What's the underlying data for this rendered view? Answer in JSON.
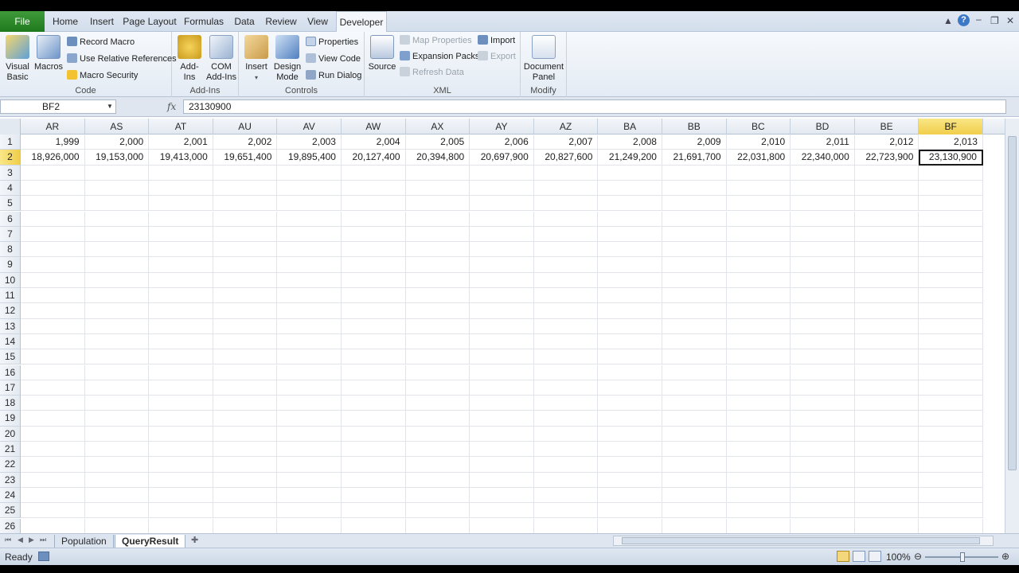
{
  "tabs": {
    "file": "File",
    "items": [
      "Home",
      "Insert",
      "Page Layout",
      "Formulas",
      "Data",
      "Review",
      "View",
      "Developer"
    ],
    "active": "Developer"
  },
  "ribbon": {
    "code": {
      "title": "Code",
      "visual_basic": "Visual\nBasic",
      "macros": "Macros",
      "record_macro": "Record Macro",
      "use_relative": "Use Relative References",
      "macro_security": "Macro Security"
    },
    "addins": {
      "title": "Add-Ins",
      "addins": "Add-Ins",
      "com_addins": "COM\nAdd-Ins"
    },
    "controls": {
      "title": "Controls",
      "insert": "Insert",
      "design_mode": "Design\nMode",
      "properties": "Properties",
      "view_code": "View Code",
      "run_dialog": "Run Dialog"
    },
    "xml": {
      "title": "XML",
      "source": "Source",
      "map_properties": "Map Properties",
      "expansion_packs": "Expansion Packs",
      "refresh_data": "Refresh Data",
      "import": "Import",
      "export": "Export"
    },
    "modify": {
      "title": "Modify",
      "document_panel": "Document\nPanel"
    }
  },
  "formula_bar": {
    "name_box": "BF2",
    "fx": "fx",
    "value": "23130900"
  },
  "sheet": {
    "columns": [
      "AR",
      "AS",
      "AT",
      "AU",
      "AV",
      "AW",
      "AX",
      "AY",
      "AZ",
      "BA",
      "BB",
      "BC",
      "BD",
      "BE",
      "BF"
    ],
    "selected_column": "BF",
    "rows": [
      "1",
      "2",
      "3",
      "4",
      "5",
      "6",
      "7",
      "8",
      "9",
      "10",
      "11",
      "12",
      "13",
      "14",
      "15",
      "16",
      "17",
      "18",
      "19",
      "20",
      "21",
      "22",
      "23",
      "24",
      "25",
      "26"
    ],
    "selected_row": "2",
    "row1": [
      "1,999",
      "2,000",
      "2,001",
      "2,002",
      "2,003",
      "2,004",
      "2,005",
      "2,006",
      "2,007",
      "2,008",
      "2,009",
      "2,010",
      "2,011",
      "2,012",
      "2,013"
    ],
    "row2": [
      "18,926,000",
      "19,153,000",
      "19,413,000",
      "19,651,400",
      "19,895,400",
      "20,127,400",
      "20,394,800",
      "20,697,900",
      "20,827,600",
      "21,249,200",
      "21,691,700",
      "22,031,800",
      "22,340,000",
      "22,723,900",
      "23,130,900"
    ]
  },
  "sheet_tabs": [
    "Population",
    "QueryResult"
  ],
  "active_sheet": "QueryResult",
  "status": {
    "ready": "Ready",
    "zoom": "100%"
  },
  "colors": {
    "file_tab": "#2a862a",
    "selected_header": "#f1cd49",
    "ribbon_bg": "#e4ebf4"
  }
}
